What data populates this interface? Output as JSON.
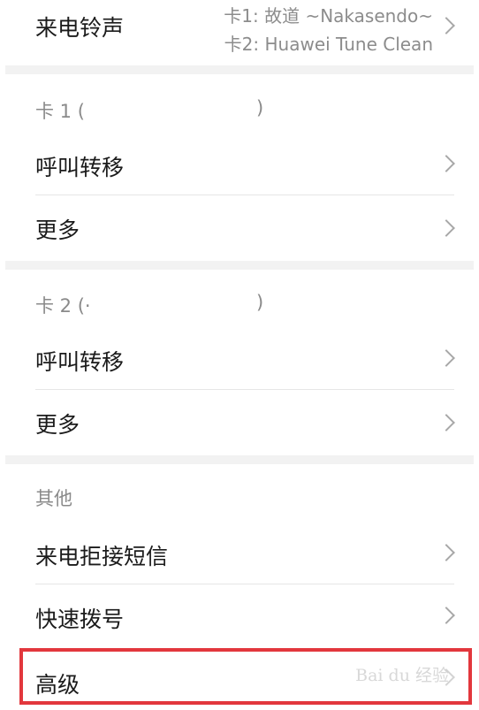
{
  "ringtone": {
    "label": "来电铃声",
    "sim1_value": "卡1: 故道 ~Nakasendo~",
    "sim2_value": "卡2: Huawei Tune Clean"
  },
  "sim1": {
    "header": "卡 1 (",
    "header_close": ")",
    "call_forwarding": "呼叫转移",
    "more": "更多"
  },
  "sim2": {
    "header": "卡 2 (·",
    "header_close": ")",
    "call_forwarding": "呼叫转移",
    "more": "更多"
  },
  "other": {
    "header": "其他",
    "reject_sms": "来电拒接短信",
    "speed_dial": "快速拨号",
    "advanced": "高级"
  },
  "watermark": "Bai du 经验",
  "highlight_color": "#e2373d"
}
